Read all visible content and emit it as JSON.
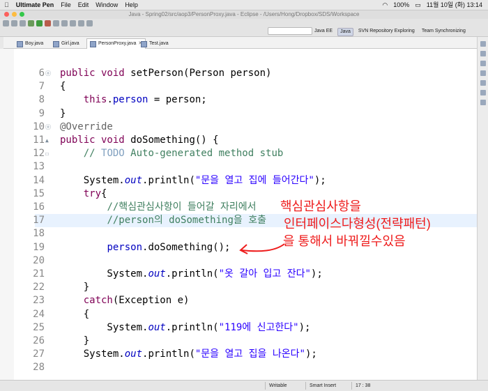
{
  "macos_menubar": {
    "app_name": "Ultimate Pen",
    "menus": [
      "File",
      "Edit",
      "Window",
      "Help"
    ],
    "battery": "100%",
    "clock": "11월 10일 (화)  13:14"
  },
  "window": {
    "title": "Java - Spring02/src/aop3/PersonProxy.java - Eclipse - /Users/Hong/Dropbox/SDS/Workspace"
  },
  "perspectives": [
    "Java EE",
    "Java",
    "SVN Repository Exploring",
    "Team Synchronizing"
  ],
  "editor_tabs": [
    {
      "label": "Boy.java"
    },
    {
      "label": "Girl.java"
    },
    {
      "label": "PersonProxy.java",
      "active": true
    },
    {
      "label": "Test.java"
    }
  ],
  "code_lines": [
    {
      "n": "6",
      "marker": "ⓞ",
      "tokens": [
        {
          "t": "public void ",
          "c": "kw"
        },
        {
          "t": "setPerson(Person person)",
          "c": ""
        }
      ]
    },
    {
      "n": "7",
      "tokens": [
        {
          "t": "{",
          "c": ""
        }
      ]
    },
    {
      "n": "8",
      "tokens": [
        {
          "t": "    ",
          "c": ""
        },
        {
          "t": "this",
          "c": "kw"
        },
        {
          "t": ".",
          "c": ""
        },
        {
          "t": "person",
          "c": "fld"
        },
        {
          "t": " = person;",
          "c": ""
        }
      ]
    },
    {
      "n": "9",
      "tokens": [
        {
          "t": "}",
          "c": ""
        }
      ]
    },
    {
      "n": "10",
      "marker": "ⓞ",
      "tokens": [
        {
          "t": "@Override",
          "c": "ann"
        }
      ]
    },
    {
      "n": "11",
      "marker": "▲",
      "tokens": [
        {
          "t": "public void ",
          "c": "kw"
        },
        {
          "t": "doSomething() {",
          "c": ""
        }
      ]
    },
    {
      "n": "12",
      "marker": "☐",
      "tokens": [
        {
          "t": "    ",
          "c": ""
        },
        {
          "t": "// ",
          "c": "cm"
        },
        {
          "t": "TODO",
          "c": "todo"
        },
        {
          "t": " Auto-generated method stub",
          "c": "cm"
        }
      ]
    },
    {
      "n": "13",
      "tokens": []
    },
    {
      "n": "14",
      "tokens": [
        {
          "t": "    System.",
          "c": ""
        },
        {
          "t": "out",
          "c": "it"
        },
        {
          "t": ".println(",
          "c": ""
        },
        {
          "t": "\"문을 열고 집에 들어간다\"",
          "c": "str"
        },
        {
          "t": ");",
          "c": ""
        }
      ]
    },
    {
      "n": "15",
      "tokens": [
        {
          "t": "    ",
          "c": ""
        },
        {
          "t": "try",
          "c": "kw"
        },
        {
          "t": "{",
          "c": ""
        }
      ]
    },
    {
      "n": "16",
      "tokens": [
        {
          "t": "        ",
          "c": ""
        },
        {
          "t": "//핵심관심사항이 들어갈 자리에서",
          "c": "cm"
        }
      ]
    },
    {
      "n": "17",
      "tokens": [
        {
          "t": "        ",
          "c": ""
        },
        {
          "t": "//person의 doSomething을 호출",
          "c": "cm"
        }
      ]
    },
    {
      "n": "18",
      "tokens": []
    },
    {
      "n": "19",
      "tokens": [
        {
          "t": "        ",
          "c": ""
        },
        {
          "t": "person",
          "c": "fld"
        },
        {
          "t": ".doSomething();",
          "c": ""
        }
      ]
    },
    {
      "n": "20",
      "tokens": []
    },
    {
      "n": "21",
      "tokens": [
        {
          "t": "        System.",
          "c": ""
        },
        {
          "t": "out",
          "c": "it"
        },
        {
          "t": ".println(",
          "c": ""
        },
        {
          "t": "\"옷 갈아 입고 잔다\"",
          "c": "str"
        },
        {
          "t": ");",
          "c": ""
        }
      ]
    },
    {
      "n": "22",
      "tokens": [
        {
          "t": "    }",
          "c": ""
        }
      ]
    },
    {
      "n": "23",
      "tokens": [
        {
          "t": "    ",
          "c": ""
        },
        {
          "t": "catch",
          "c": "kw"
        },
        {
          "t": "(Exception e)",
          "c": ""
        }
      ]
    },
    {
      "n": "24",
      "tokens": [
        {
          "t": "    {",
          "c": ""
        }
      ]
    },
    {
      "n": "25",
      "tokens": [
        {
          "t": "        System.",
          "c": ""
        },
        {
          "t": "out",
          "c": "it"
        },
        {
          "t": ".println(",
          "c": ""
        },
        {
          "t": "\"119에 신고한다\"",
          "c": "str"
        },
        {
          "t": ");",
          "c": ""
        }
      ]
    },
    {
      "n": "26",
      "tokens": [
        {
          "t": "    }",
          "c": ""
        }
      ]
    },
    {
      "n": "27",
      "tokens": [
        {
          "t": "    System.",
          "c": ""
        },
        {
          "t": "out",
          "c": "it"
        },
        {
          "t": ".println(",
          "c": ""
        },
        {
          "t": "\"문을 열고 집을 나온다\"",
          "c": "str"
        },
        {
          "t": ");",
          "c": ""
        }
      ]
    },
    {
      "n": "28",
      "tokens": []
    }
  ],
  "highlighted_line": "17",
  "annotation_lines": [
    "핵심관심사항을",
    "인터페이스다형성(전략패턴)",
    "을 통해서 바꿔낄수있음"
  ],
  "status_bar": {
    "mode": "Writable",
    "insert": "Smart Insert",
    "position": "17 : 38"
  },
  "colors": {
    "annotation": "#ee1b1b",
    "keyword": "#7f0055",
    "string": "#2a00ff",
    "comment": "#3f7f5f"
  }
}
